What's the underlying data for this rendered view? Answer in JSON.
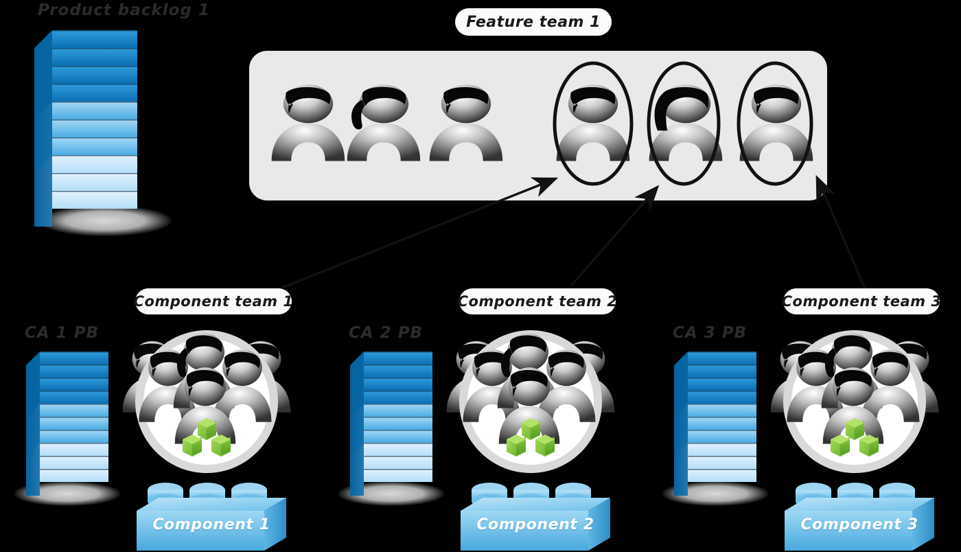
{
  "diagram": {
    "title_labels": {
      "product_backlog": "Product backlog 1",
      "feature_team": "Feature team 1"
    },
    "feature_team": {
      "label": "Feature team 1",
      "member_count": 6,
      "members": [
        {
          "id": 1,
          "hair": "short",
          "circled": false
        },
        {
          "id": 2,
          "hair": "ponytail",
          "circled": false
        },
        {
          "id": 3,
          "hair": "short",
          "circled": false
        },
        {
          "id": 4,
          "hair": "short",
          "circled": true
        },
        {
          "id": 5,
          "hair": "bob",
          "circled": true
        },
        {
          "id": 6,
          "hair": "short",
          "circled": true
        }
      ]
    },
    "product_backlog": {
      "label": "Product backlog 1",
      "slab_count": 10
    },
    "component_groups": [
      {
        "backlog_label": "CA 1 PB",
        "team_label": "Component team 1",
        "component_label": "Component 1",
        "team_size": 6,
        "cube_count": 3,
        "backlog_slab_count": 10
      },
      {
        "backlog_label": "CA 2 PB",
        "team_label": "Component team 2",
        "component_label": "Component 2",
        "team_size": 6,
        "cube_count": 3,
        "backlog_slab_count": 10
      },
      {
        "backlog_label": "CA 3 PB",
        "team_label": "Component team 3",
        "component_label": "Component 3",
        "team_size": 6,
        "cube_count": 3,
        "backlog_slab_count": 10
      }
    ],
    "connections": [
      {
        "from": "Component team 1",
        "to": "Feature team 1 member 4"
      },
      {
        "from": "Component team 2",
        "to": "Feature team 1 member 5"
      },
      {
        "from": "Component team 3",
        "to": "Feature team 1 member 6"
      }
    ],
    "colors": {
      "background": "#000000",
      "panel": "#e9e9e9",
      "bubble": "#fbfbfb",
      "hand_text": "#2b2b2b",
      "backlog_dark": "#0f7ec4",
      "backlog_mid": "#6ec0ee",
      "backlog_light": "#d7ecfa",
      "lego": "#6cc4ef",
      "cube_green": "#7ac143",
      "stroke": "#111111"
    }
  }
}
